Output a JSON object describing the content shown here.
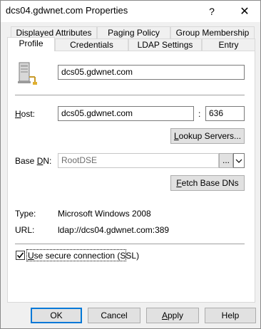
{
  "window": {
    "title": "dcs04.gdwnet.com Properties",
    "help_glyph": "?",
    "close_glyph": "✕"
  },
  "tabs_back": [
    {
      "label": "Displayed Attributes"
    },
    {
      "label": "Paging Policy"
    },
    {
      "label": "Group Membership"
    }
  ],
  "tabs_front": [
    {
      "label": "Profile",
      "active": true
    },
    {
      "label": "Credentials"
    },
    {
      "label": "LDAP Settings"
    },
    {
      "label": "Entry"
    }
  ],
  "profile": {
    "name_value": "dcs05.gdwnet.com",
    "host_label": "Host:",
    "host_value": "dcs05.gdwnet.com",
    "port_sep": ":",
    "port_value": "636",
    "lookup_label": "Lookup Servers...",
    "basedn_label": "Base DN:",
    "basedn_value": "RootDSE",
    "browse_label": "...",
    "dropdown_glyph": "⌄",
    "fetch_label": "Fetch Base DNs",
    "type_label": "Type:",
    "type_value": "Microsoft Windows 2008",
    "url_label": "URL:",
    "url_value": "ldap://dcs04.gdwnet.com:389",
    "ssl_label": "Use secure connection (SSL)",
    "ssl_checked": true
  },
  "footer": {
    "ok": "OK",
    "cancel": "Cancel",
    "apply": "Apply",
    "help": "Help"
  },
  "icons": [
    "server-icon",
    "help-icon",
    "close-icon",
    "chevron-down-icon",
    "checkmark-icon"
  ]
}
